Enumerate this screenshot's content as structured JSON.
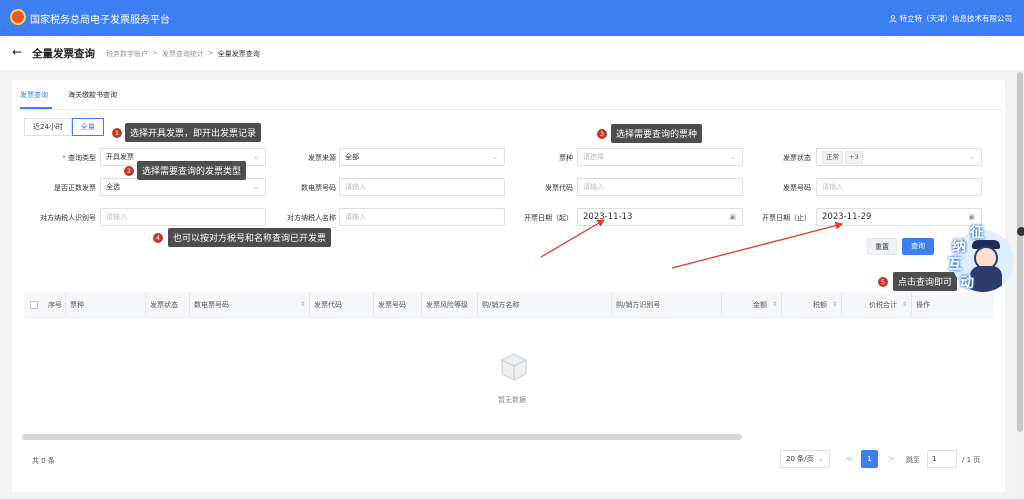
{
  "header": {
    "app_title": "国家税务总局电子发票服务平台",
    "user": "特立特（天津）信息技术有限公司"
  },
  "page": {
    "title": "全量发票查询",
    "breadcrumbs": [
      "税务数字账户",
      ">",
      "发票查询统计",
      ">",
      "全量发票查询"
    ]
  },
  "tabs": [
    {
      "label": "发票查询"
    },
    {
      "label": "海关缴款书查询"
    }
  ],
  "range_toggle": [
    "近24小时",
    "全量"
  ],
  "form": {
    "query_type_label": "查询类型",
    "query_type_value": "开具发票",
    "source_label": "发票来源",
    "source_value": "全部",
    "kind_label": "票种",
    "kind_placeholder": "请选择",
    "status_label": "发票状态",
    "status_tag1": "正常",
    "status_tag2": "+3",
    "positive_label": "是否正数发票",
    "positive_value": "全选",
    "digital_no_label": "数电票号码",
    "digital_no_placeholder": "请输入",
    "code_label": "发票代码",
    "code_placeholder": "请输入",
    "no_label": "发票号码",
    "no_placeholder": "请输入",
    "counter_tax_id_label": "对方纳税人识别号",
    "counter_tax_id_placeholder": "请输入",
    "counter_name_label": "对方纳税人名称",
    "counter_name_placeholder": "请输入",
    "date_start_label": "开票日期（起）",
    "date_start_value": "2023-11-13",
    "date_end_label": "开票日期（止）",
    "date_end_value": "2023-11-29",
    "reset": "重置",
    "query": "查询"
  },
  "annotations": [
    {
      "num": "1",
      "text": "选择开具发票，即开出发票记录"
    },
    {
      "num": "2",
      "text": "选择需要查询的发票类型"
    },
    {
      "num": "3",
      "text": "选择需要查询的票种"
    },
    {
      "num": "4",
      "text": "也可以按对方税号和名称查询已开发票"
    },
    {
      "num": "5",
      "text": "点击查询即可"
    }
  ],
  "table": {
    "columns": [
      "序号",
      "票种",
      "发票状态",
      "数电票号码",
      "发票代码",
      "发票号码",
      "发票风险等级",
      "购/销方名称",
      "购/销方识别号",
      "金额",
      "税额",
      "价税合计",
      "操作"
    ],
    "empty_text": "暂无数据"
  },
  "pagination": {
    "total": "共 0 条",
    "page_size": "20 条/页",
    "prev": "<",
    "current": "1",
    "next": ">",
    "jump_label": "跳至",
    "jump_value": "1",
    "total_pages": "/ 1 页"
  },
  "mascot": [
    "征",
    "纳",
    "互",
    "动"
  ],
  "colors": {
    "primary": "#3d7ef0",
    "annotation_bg": "#4d4d4d",
    "arrow": "#e03a2f"
  }
}
